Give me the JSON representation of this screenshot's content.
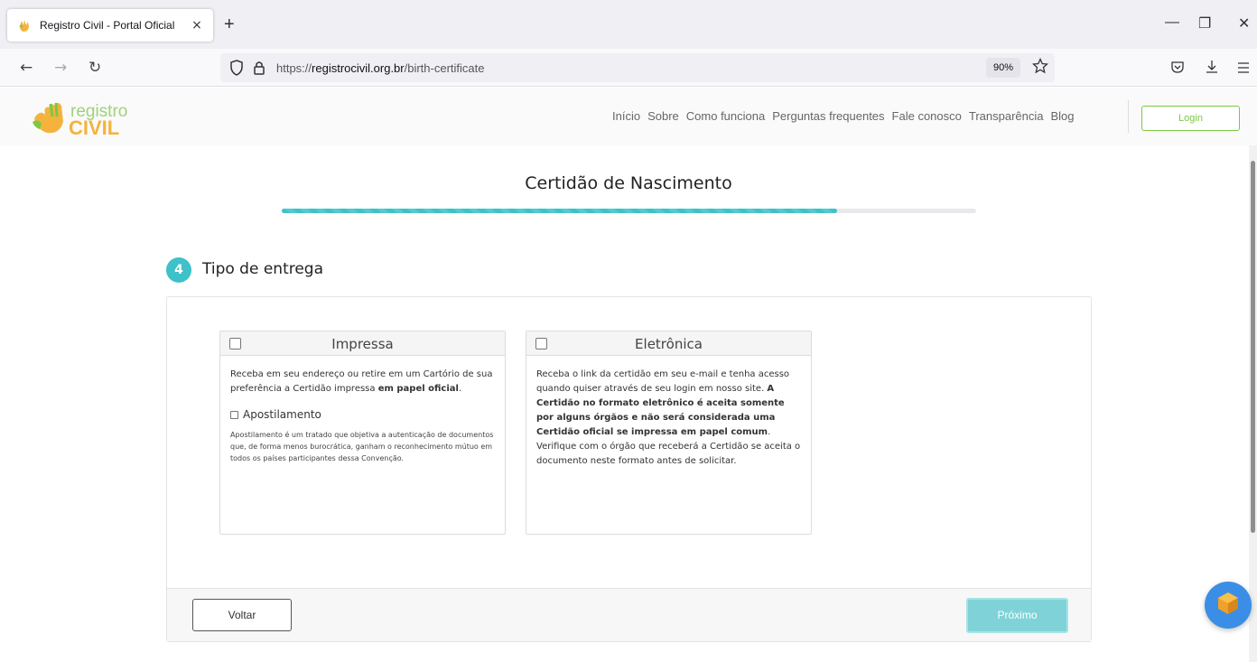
{
  "browser": {
    "tab_title": "Registro Civil - Portal Oficial",
    "tab_close": "×",
    "new_tab": "+",
    "url_prefix": "https://",
    "url_host": "registrocivil.org.br",
    "url_path": "/birth-certificate",
    "zoom": "90%",
    "window_controls": {
      "minimize": "—",
      "restore": "❐",
      "close": "✕"
    },
    "nav": {
      "back": "←",
      "forward": "→",
      "reload": "↻"
    }
  },
  "site": {
    "logo_line1": "registro",
    "logo_line2": "CIVIL",
    "menu": [
      "Início",
      "Sobre",
      "Como funciona",
      "Perguntas frequentes",
      "Fale conosco",
      "Transparência",
      "Blog"
    ],
    "login_label": "Login"
  },
  "page": {
    "title": "Certidão de Nascimento",
    "progress_fraction": 0.8
  },
  "step": {
    "number": "4",
    "title": "Tipo de entrega"
  },
  "options": {
    "impressa": {
      "name": "Impressa",
      "desc_start": "Receba em seu endereço ou retire em um Cartório de sua preferência a Certidão impressa ",
      "desc_bold": "em papel oficial",
      "desc_end": ".",
      "apostilamento_label": "Apostilamento",
      "apostilamento_desc": "Apostilamento é um tratado que objetiva a autenticação de documentos que, de forma menos burocrática, ganham o reconhecimento mútuo em todos os países participantes dessa Convenção."
    },
    "eletronica": {
      "name": "Eletrônica",
      "desc_start": "Receba o link da certidão em seu e-mail e tenha acesso quando quiser através de seu login em nosso site. ",
      "desc_bold": "A Certidão no formato eletrônico é aceita somente por alguns órgãos e não será considerada uma Certidão oficial se impressa em papel comum",
      "desc_end": ". Verifique com o órgão que receberá a Certidão se aceita o documento neste formato antes de solicitar."
    }
  },
  "footer": {
    "back_label": "Voltar",
    "next_label": "Próximo"
  },
  "colors": {
    "accent": "#3ec1c9",
    "brand_green": "#7ac943",
    "next_button": "#7fd3d8"
  }
}
